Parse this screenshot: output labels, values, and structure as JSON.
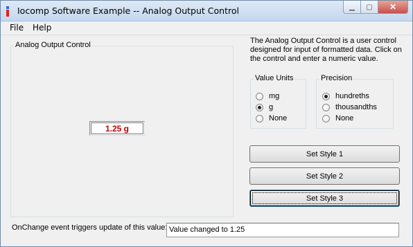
{
  "window": {
    "title": "Iocomp Software Example -- Analog Output Control",
    "minimize_glyph": "▁",
    "maximize_glyph": "▢",
    "close_glyph": "✕"
  },
  "menu": {
    "items": [
      "File",
      "Help"
    ]
  },
  "output_group": {
    "legend": "Analog Output Control",
    "value_text": "1.25 g",
    "value_color": "#c00000"
  },
  "description": "The Analog Output Control is a user control designed for input of formatted data.  Click on the control and enter a numeric value.",
  "value_units": {
    "legend": "Value Units",
    "options": [
      {
        "label": "mg",
        "checked": false
      },
      {
        "label": "g",
        "checked": true
      },
      {
        "label": "None",
        "checked": false
      }
    ]
  },
  "precision": {
    "legend": "Precision",
    "options": [
      {
        "label": "hundreths",
        "checked": true
      },
      {
        "label": "thousandths",
        "checked": false
      },
      {
        "label": "None",
        "checked": false
      }
    ]
  },
  "buttons": [
    "Set Style 1",
    "Set Style 2",
    "Set Style 3"
  ],
  "status": {
    "label": "OnChange event triggers update of this value:",
    "value": "Value changed to 1.25"
  }
}
